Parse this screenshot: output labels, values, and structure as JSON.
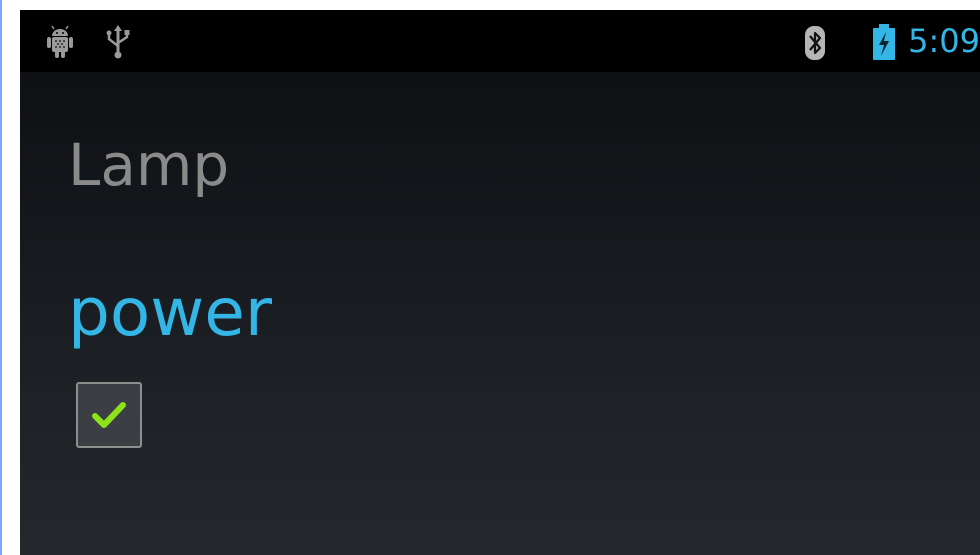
{
  "status_bar": {
    "icons": [
      "android-debug-icon",
      "usb-icon",
      "bluetooth-icon",
      "battery-charging-icon"
    ],
    "time": "5:09"
  },
  "app": {
    "title": "Lamp"
  },
  "controls": {
    "section_label": "power",
    "power_checkbox": {
      "checked": true
    }
  },
  "colors": {
    "accent": "#33b5e5",
    "title_gray": "#8a8a8a",
    "check_green": "#8ee21c",
    "status_bar_bg": "#000000"
  }
}
